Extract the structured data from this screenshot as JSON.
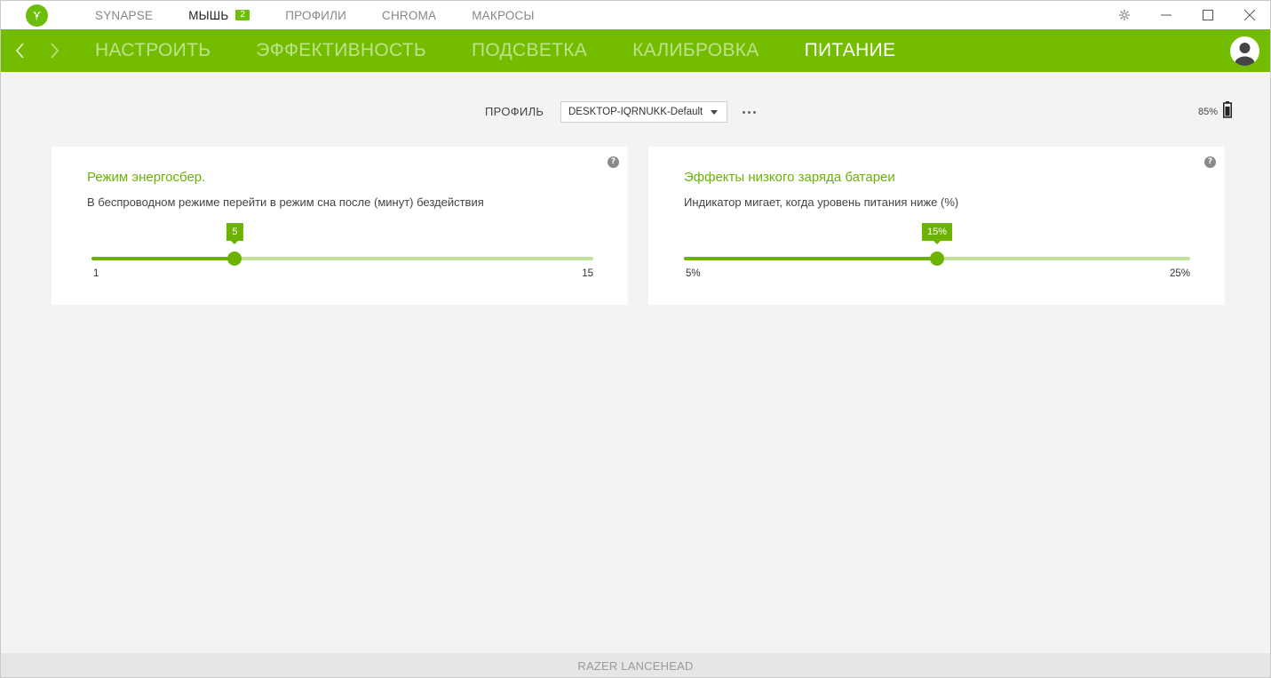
{
  "topnav": {
    "items": [
      {
        "label": "SYNAPSE"
      },
      {
        "label": "МЫШЬ",
        "badge": "2",
        "active": true
      },
      {
        "label": "ПРОФИЛИ"
      },
      {
        "label": "CHROMA"
      },
      {
        "label": "МАКРОСЫ"
      }
    ]
  },
  "subnav": {
    "items": [
      {
        "label": "НАСТРОИТЬ"
      },
      {
        "label": "ЭФФЕКТИВНОСТЬ"
      },
      {
        "label": "ПОДСВЕТКА"
      },
      {
        "label": "КАЛИБРОВКА"
      },
      {
        "label": "ПИТАНИЕ",
        "active": true
      }
    ]
  },
  "profile": {
    "label": "ПРОФИЛЬ",
    "selected": "DESKTOP-IQRNUKK-Default"
  },
  "battery": {
    "percent_label": "85%",
    "level": 0.85
  },
  "cards": {
    "sleep": {
      "title": "Режим энергосбер.",
      "description": "В беспроводном режиме перейти в режим сна после (минут) бездействия",
      "value_label": "5",
      "value": 5,
      "min_label": "1",
      "max_label": "15",
      "min": 1,
      "max": 15
    },
    "low_battery": {
      "title": "Эффекты низкого заряда батареи",
      "description": "Индикатор мигает, когда уровень питания ниже (%)",
      "value_label": "15%",
      "value": 15,
      "min_label": "5%",
      "max_label": "25%",
      "min": 5,
      "max": 25
    }
  },
  "help_icon_glyph": "?",
  "footer": {
    "device": "RAZER LANCEHEAD"
  },
  "colors": {
    "accent": "#73bc00",
    "accent_dark": "#6bb300",
    "track_light": "#bfe294"
  }
}
